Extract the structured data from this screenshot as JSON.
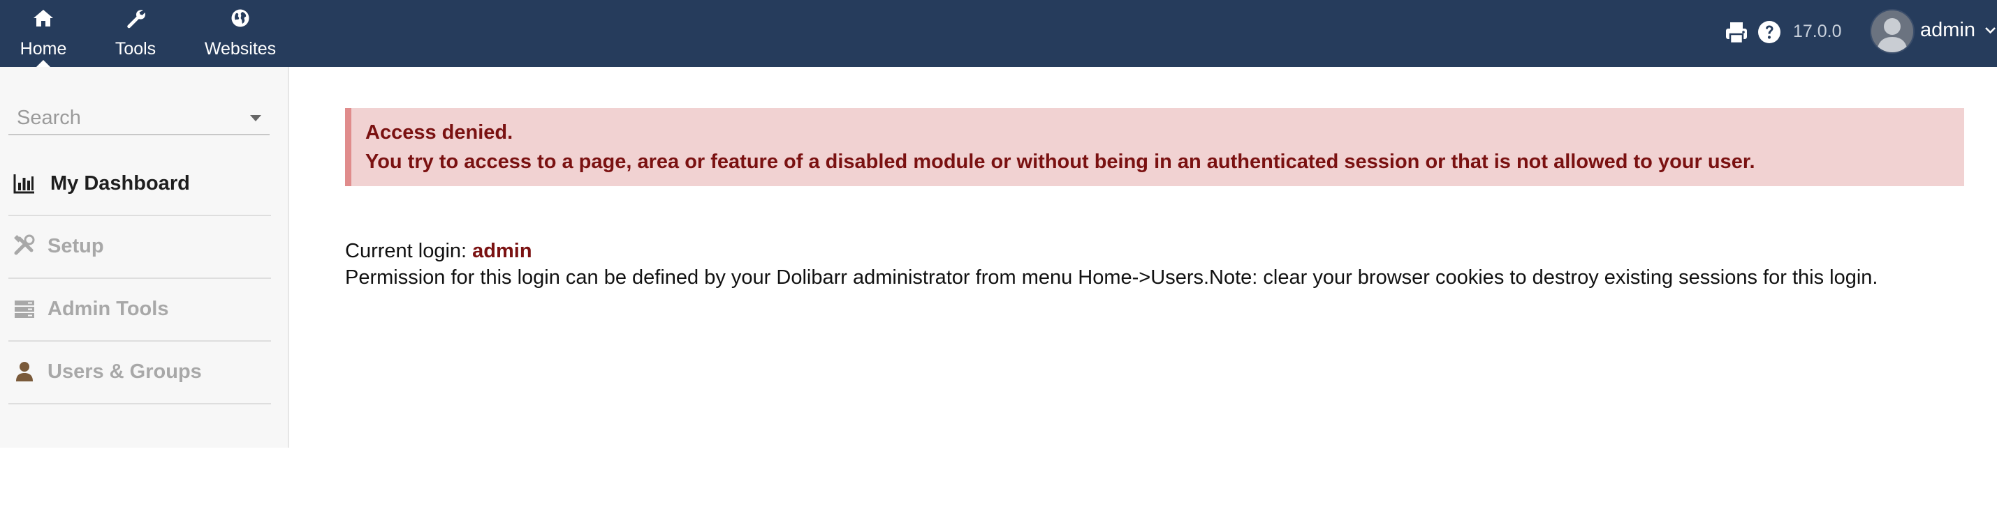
{
  "topnav": {
    "items": [
      {
        "label": "Home",
        "icon": "home-icon"
      },
      {
        "label": "Tools",
        "icon": "wrench-icon"
      },
      {
        "label": "Websites",
        "icon": "globe-icon"
      }
    ]
  },
  "topright": {
    "version": "17.0.0",
    "user": "admin"
  },
  "sidebar": {
    "search_placeholder": "Search",
    "items": [
      {
        "label": "My Dashboard",
        "icon": "bar-chart-icon",
        "state": "active"
      },
      {
        "label": "Setup",
        "icon": "tools-icon",
        "state": "disabled"
      },
      {
        "label": "Admin Tools",
        "icon": "server-icon",
        "state": "disabled"
      },
      {
        "label": "Users & Groups",
        "icon": "user-icon",
        "state": "disabled"
      }
    ]
  },
  "main": {
    "alert_title": "Access denied.",
    "alert_message": "You try to access to a page, area or feature of a disabled module or without being in an authenticated session or that is not allowed to your user.",
    "current_login_label": "Current login:",
    "current_login_user": "admin",
    "permission_note": "Permission for this login can be defined by your Dolibarr administrator from menu Home->Users.Note: clear your browser cookies to destroy existing sessions for this login."
  },
  "colors": {
    "topbar": "#263c5c",
    "alert_bg": "#f1d2d2",
    "alert_border": "#e08c8c",
    "alert_text": "#7a1111"
  }
}
